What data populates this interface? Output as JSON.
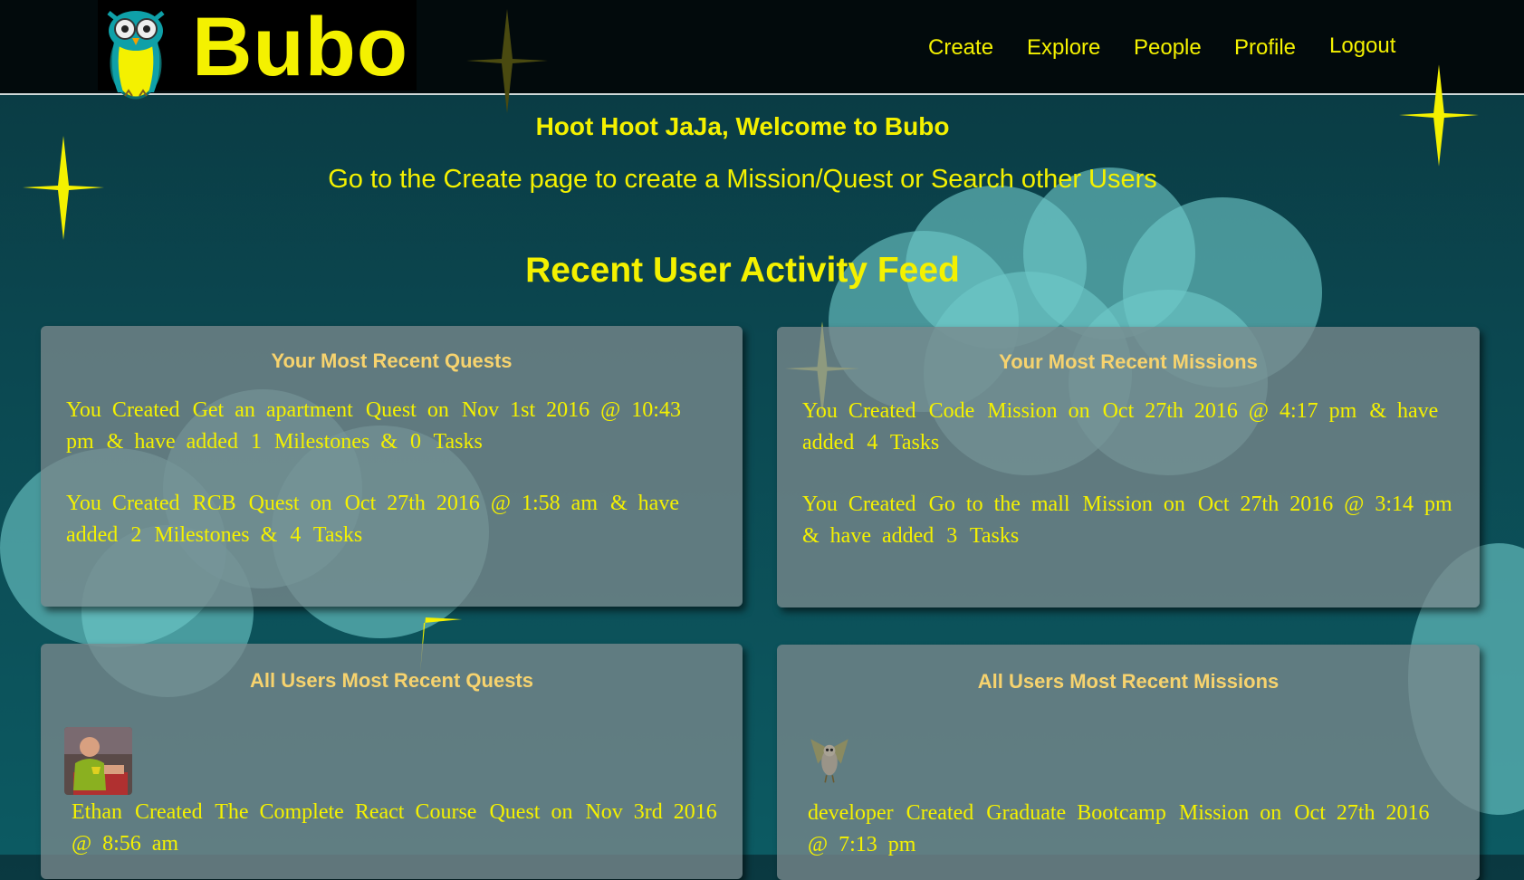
{
  "nav": {
    "brand": "Bubo",
    "links": [
      "Create",
      "Explore",
      "People",
      "Profile",
      "Logout"
    ]
  },
  "welcome": {
    "prefix": "Hoot Hoot",
    "username": "JaJa",
    "suffix": ", Welcome to Bubo"
  },
  "subtitle": "Go to the Create page to create a Mission/Quest or Search other Users",
  "feed_title": "Recent User Activity Feed",
  "panels": {
    "your_quests": {
      "title": "Your Most Recent Quests",
      "entries": [
        {
          "lead": "You Created",
          "name": "Get an apartment",
          "kind": "Quest on",
          "date": "Nov 1st 2016 @ 10:43 pm",
          "amp": "& have added",
          "milestones": "1",
          "ms_label": "Milestones &",
          "tasks": "0",
          "tasks_label": "Tasks"
        },
        {
          "lead": "You Created",
          "name": "RCB",
          "kind": "Quest on",
          "date": "Oct 27th 2016 @ 1:58 am",
          "amp": "& have added",
          "milestones": "2",
          "ms_label": "Milestones &",
          "tasks": "4",
          "tasks_label": "Tasks"
        }
      ]
    },
    "your_missions": {
      "title": "Your Most Recent Missions",
      "entries": [
        {
          "lead": "You Created",
          "name": "Code",
          "kind": "Mission on",
          "date": "Oct 27th 2016 @ 4:17 pm",
          "amp": "& have added",
          "tasks": "4",
          "tasks_label": "Tasks"
        },
        {
          "lead": "You Created",
          "name": "Go to the mall",
          "kind": "Mission on",
          "date": "Oct 27th 2016 @ 3:14 pm",
          "amp": "& have added",
          "tasks": "3",
          "tasks_label": "Tasks"
        }
      ]
    },
    "all_quests": {
      "title": "All Users Most Recent Quests",
      "entries": [
        {
          "user": "Ethan",
          "lead": "Created",
          "name": "The Complete React Course",
          "kind": "Quest on",
          "date": "Nov 3rd 2016 @ 8:56 am"
        }
      ]
    },
    "all_missions": {
      "title": "All Users Most Recent Missions",
      "entries": [
        {
          "user": "developer",
          "lead": "Created",
          "name": "Graduate Bootcamp",
          "kind": "Mission on",
          "date": "Oct 27th 2016 @ 7:13 pm"
        }
      ]
    }
  },
  "colors": {
    "accent": "#f4f100",
    "panel_title": "#f7d36e",
    "navbar_bg": "#020a0c"
  },
  "icons": [
    "owl-logo-icon",
    "sparkle-star-icon",
    "user-avatar-photo",
    "owl-avatar-icon"
  ]
}
